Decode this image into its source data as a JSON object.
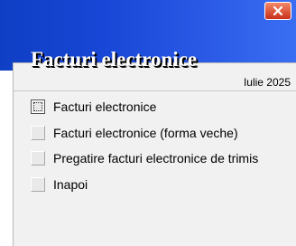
{
  "window": {
    "title": "Facturi electronice",
    "date": "Iulie 2025"
  },
  "titlebar": {
    "close_icon": "close-icon"
  },
  "menu": {
    "items": [
      {
        "label": "Facturi electronice",
        "active": true
      },
      {
        "label": "Facturi electronice (forma veche)",
        "active": false
      },
      {
        "label": "Pregatire facturi electronice de trimis",
        "active": false
      },
      {
        "label": "Inapoi",
        "active": false
      }
    ]
  },
  "colors": {
    "titlebar": "#1846d6",
    "panel": "#f1f1f1",
    "close_button": "#c9301a"
  }
}
